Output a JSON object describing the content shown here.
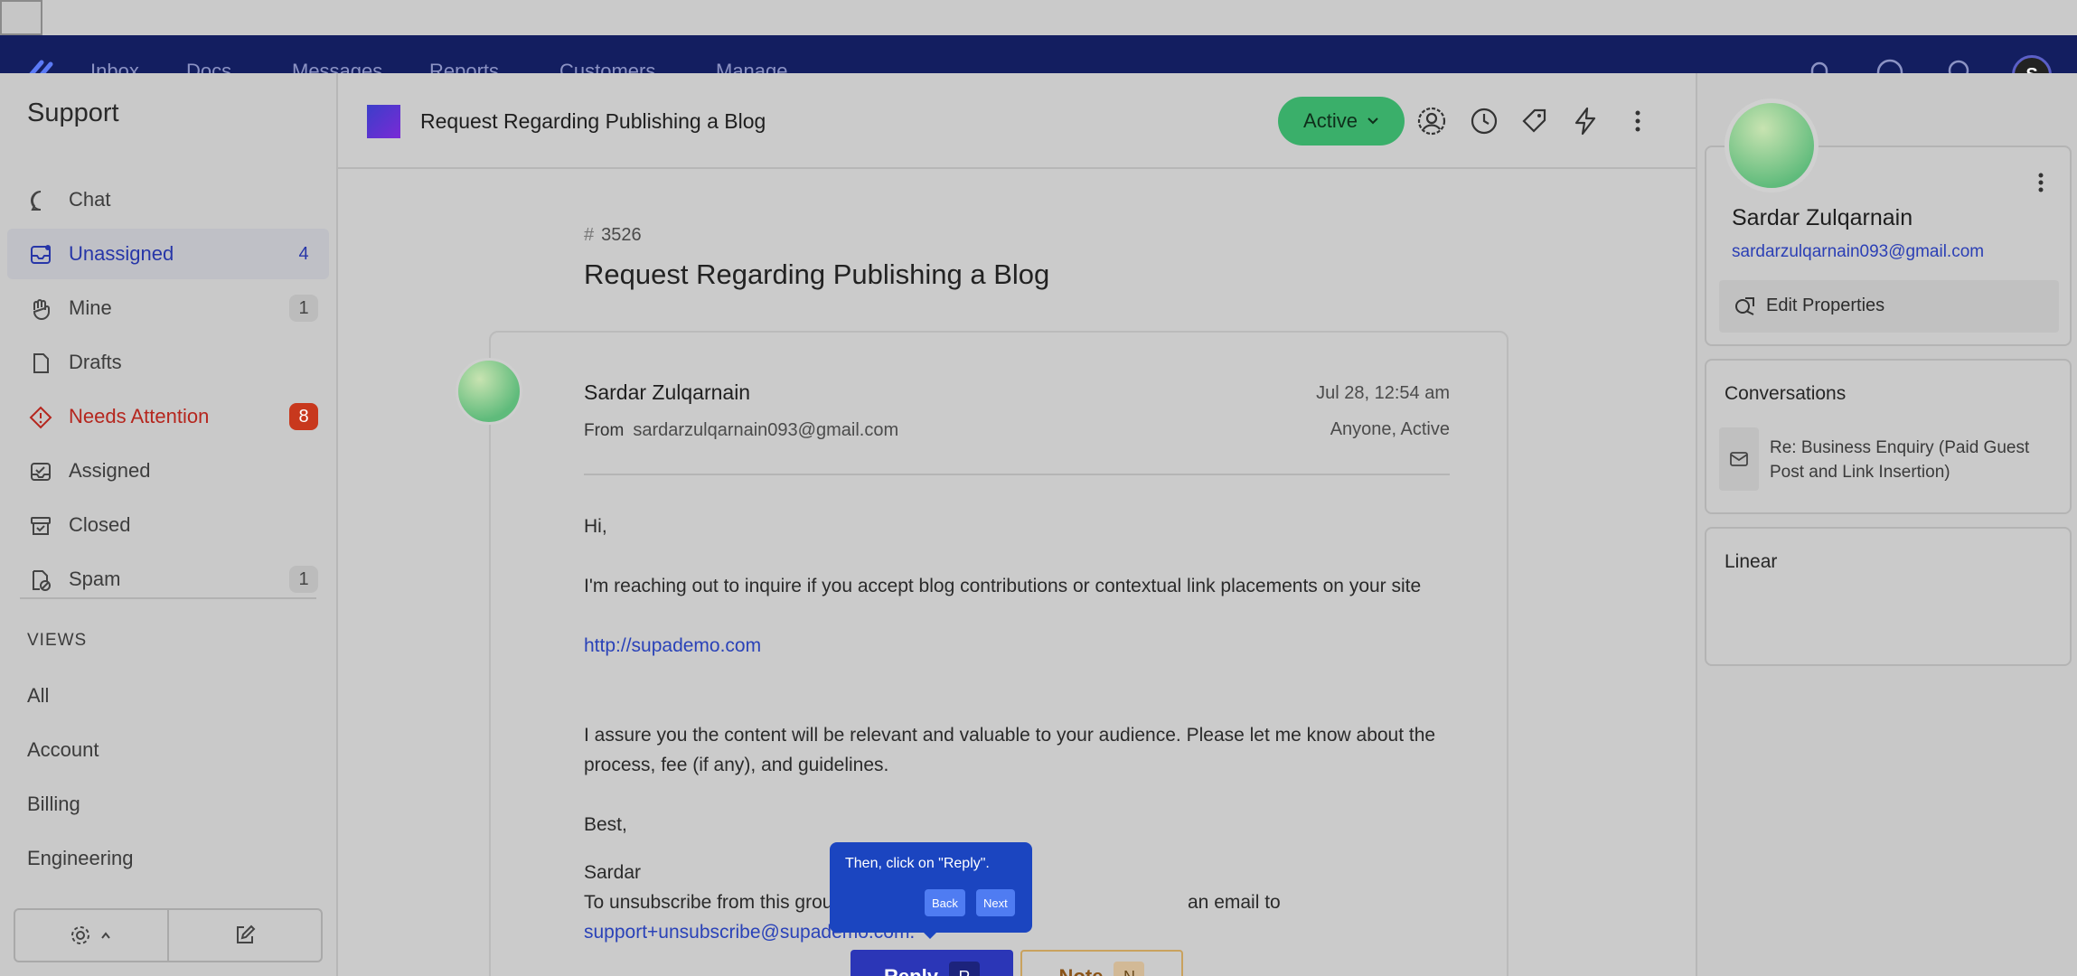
{
  "nav": {
    "items": [
      "Inbox",
      "Docs",
      "Messages",
      "Reports",
      "Customers",
      "Manage"
    ],
    "avatar_letter": "S"
  },
  "sidebar": {
    "title": "Support",
    "items": [
      {
        "label": "Chat",
        "count": ""
      },
      {
        "label": "Unassigned",
        "count": "4"
      },
      {
        "label": "Mine",
        "count": "1"
      },
      {
        "label": "Drafts",
        "count": ""
      },
      {
        "label": "Needs Attention",
        "count": "8"
      },
      {
        "label": "Assigned",
        "count": ""
      },
      {
        "label": "Closed",
        "count": ""
      },
      {
        "label": "Spam",
        "count": "1"
      }
    ],
    "views_heading": "VIEWS",
    "views": [
      "All",
      "Account",
      "Billing",
      "Engineering"
    ]
  },
  "conversation": {
    "title": "Request Regarding Publishing a Blog",
    "status": "Active",
    "ticket_number": "3526",
    "ticket_hash": "#",
    "message": {
      "sender": "Sardar Zulqarnain",
      "from_label": "From",
      "from_email": "sardarzulqarnain093@gmail.com",
      "date": "Jul 28, 12:54 am",
      "assign_status": "Anyone, Active",
      "greeting": "Hi,",
      "line1": "I'm reaching out to inquire if you accept blog contributions or contextual link placements on your site",
      "link": "http://supademo.com",
      "line2a": "I assure you the content will be relevant and valuable to your audience. Please let me know about the",
      "line2b": "process, fee (if any), and guidelines.",
      "signoff": "Best,",
      "name": "Sardar",
      "unsubscribe_a": "To unsubscribe from this group",
      "unsubscribe_b": "an email to",
      "unsubscribe_email": "support+unsubscribe@supademo.com."
    }
  },
  "tooltip": {
    "text": "Then, click on \"Reply\".",
    "back": "Back",
    "next": "Next"
  },
  "actions": {
    "reply": "Reply",
    "reply_key": "R",
    "note": "Note",
    "note_key": "N"
  },
  "customer": {
    "name": "Sardar Zulqarnain",
    "email": "sardarzulqarnain093@gmail.com",
    "edit_label": "Edit Properties",
    "conversations_title": "Conversations",
    "conversation_item": "Re: Business Enquiry (Paid Guest Post and Link Insertion)",
    "linear_title": "Linear"
  },
  "colors": {
    "accent": "#2b36b7",
    "navbar": "#131e60",
    "status_green": "#3aaf6a",
    "alert_red": "#c8381d",
    "tooltip_blue": "#1b45c0"
  }
}
